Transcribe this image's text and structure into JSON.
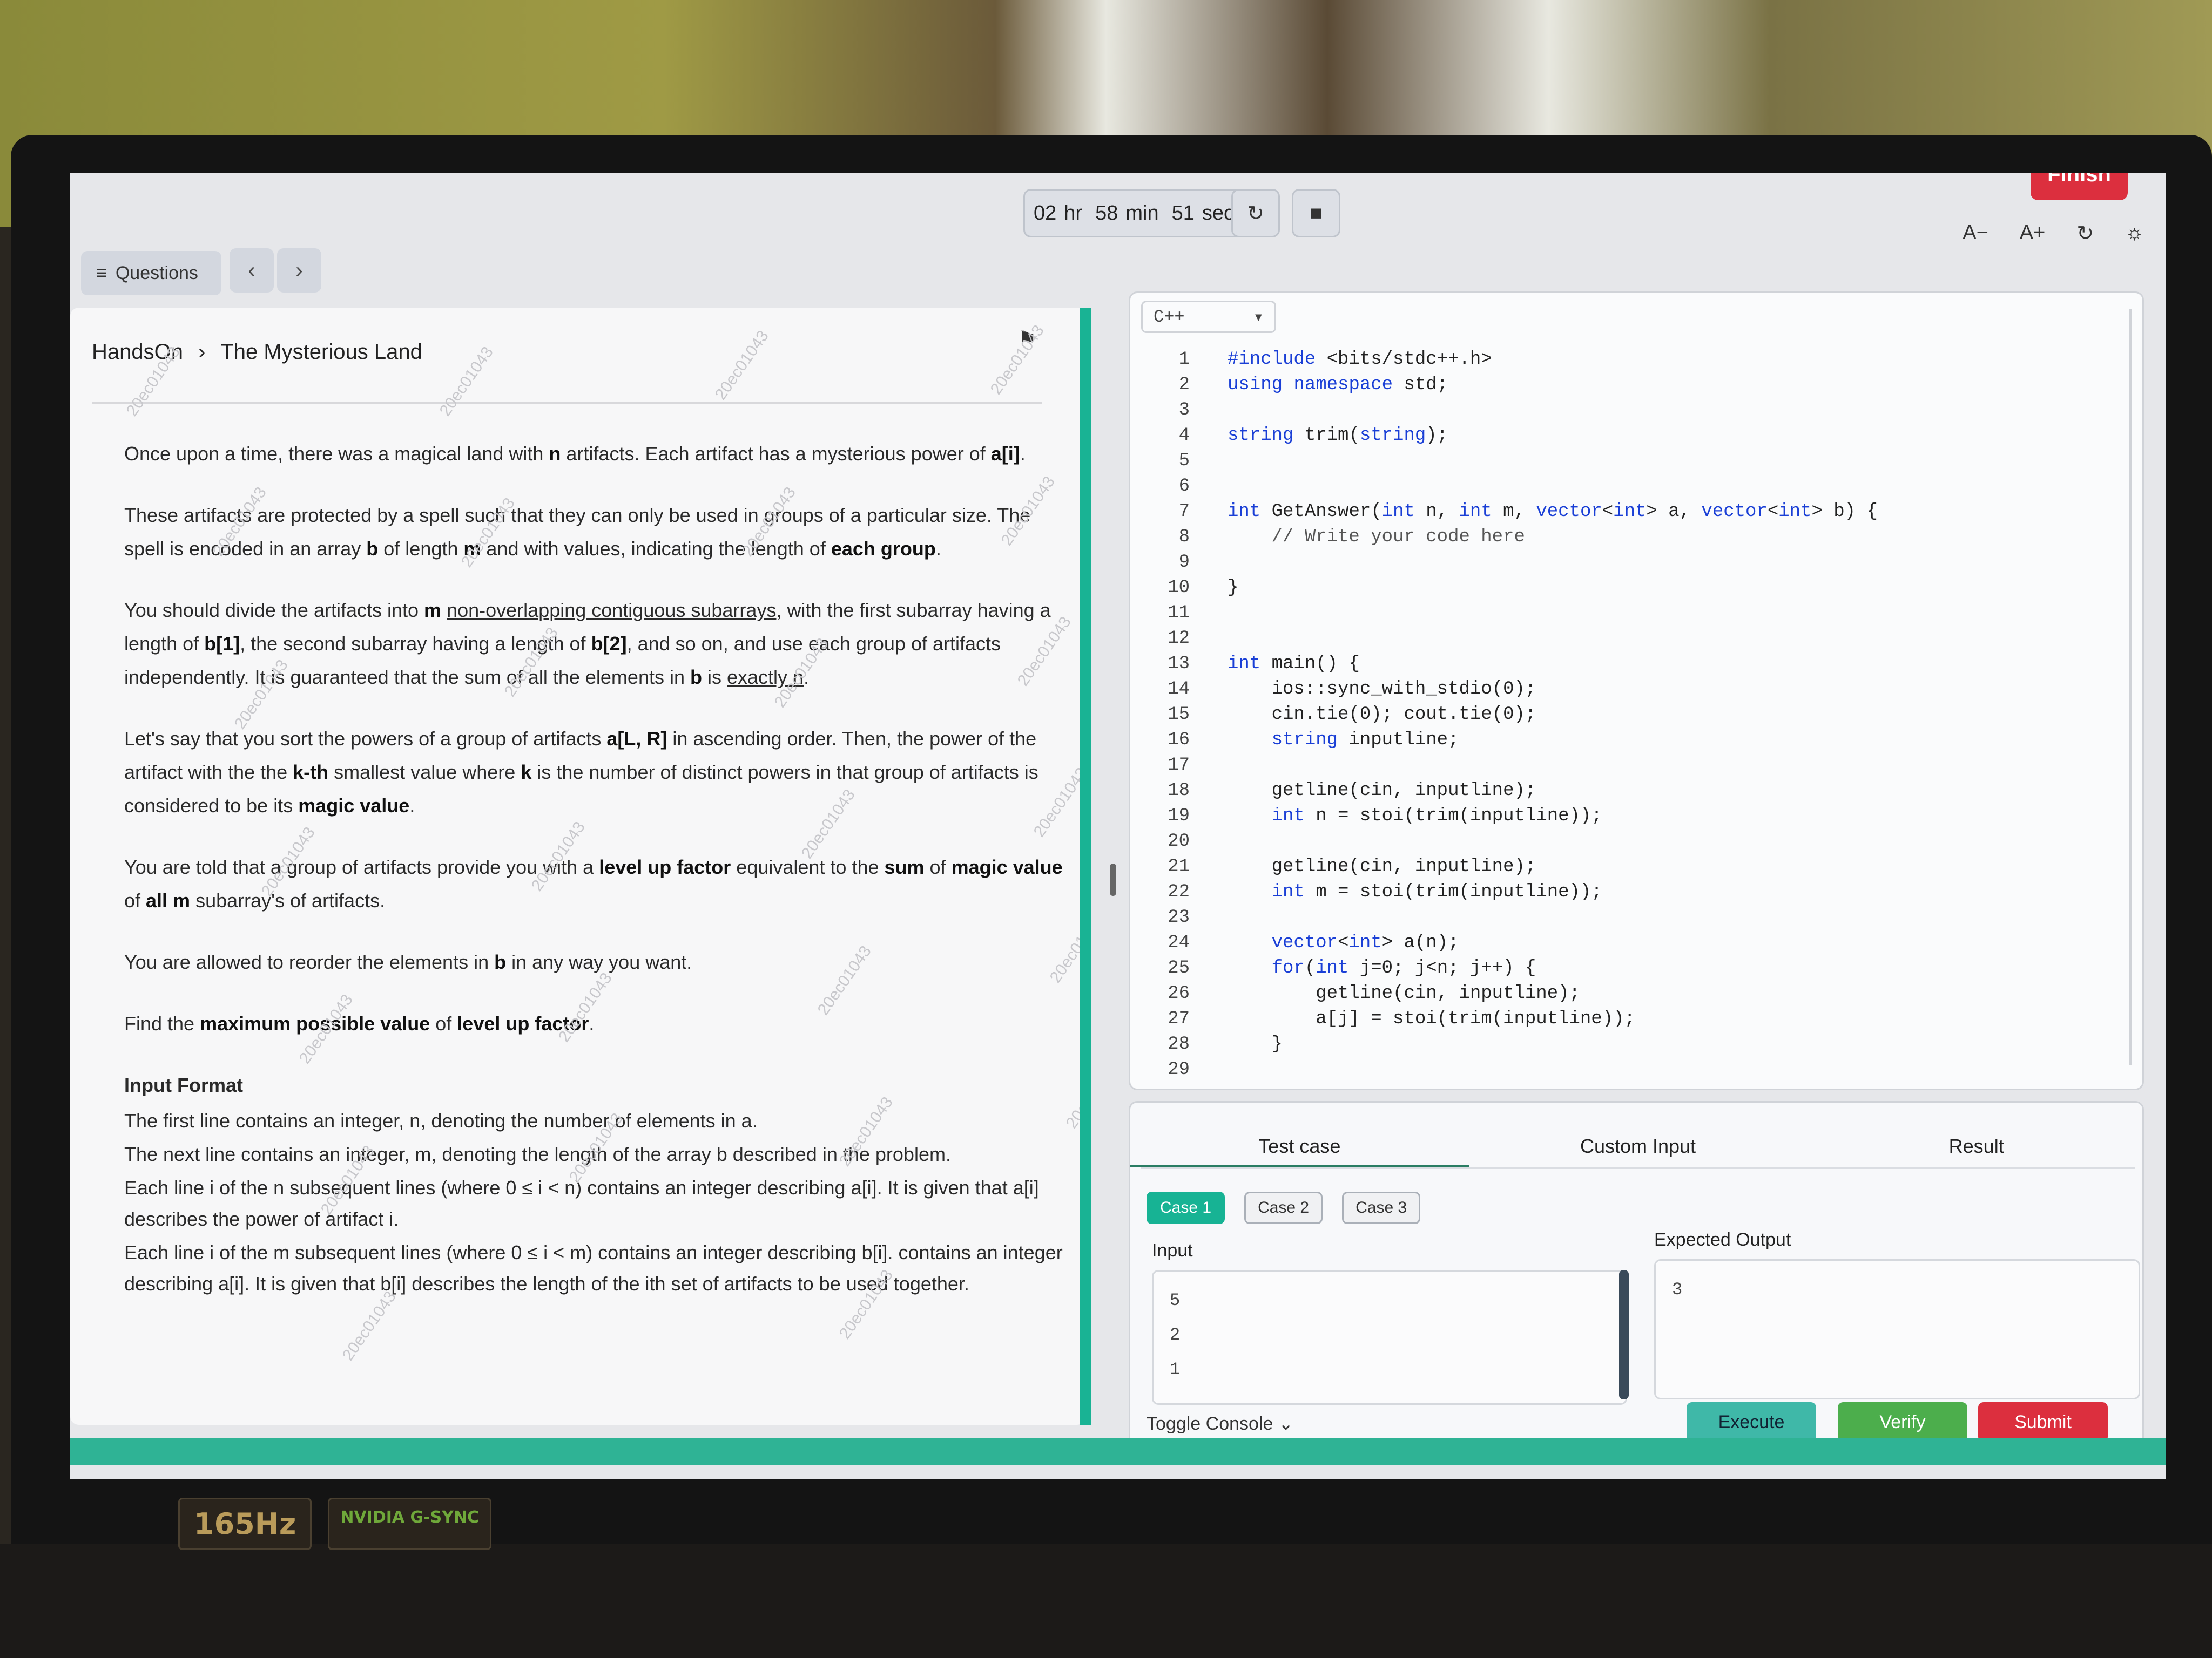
{
  "timer": {
    "hr": "02",
    "hr_unit": "hr",
    "min": "58",
    "min_unit": "min",
    "sec": "51",
    "sec_unit": "sec"
  },
  "toolbar": {
    "questions_label": "Questions",
    "prev_glyph": "‹",
    "next_glyph": "›",
    "refresh_glyph": "↻",
    "camera_glyph": "■",
    "finish_label": "Finish",
    "font_decrease": "A−",
    "font_increase": "A+",
    "reset_glyph": "↻",
    "theme_glyph": "☼"
  },
  "problem": {
    "breadcrumb_root": "HandsOn",
    "breadcrumb_sep": "›",
    "title": "The Mysterious Land",
    "flag_glyph": "⚑",
    "watermark": "20ec01043",
    "p1a": "Once upon a time, there was a magical land with ",
    "p1b": "n",
    "p1c": " artifacts. Each artifact has a mysterious power of ",
    "p1d": "a[i]",
    "p1e": ".",
    "p2a": "These artifacts are protected by a spell such that they can only be used in groups of a particular size. The spell is encoded in an array ",
    "p2b": "b",
    "p2c": " of length ",
    "p2d": "m",
    "p2e": " and with values, indicating the length of ",
    "p2f": "each group",
    "p2g": ".",
    "p3a": "You should divide the artifacts into ",
    "p3b": "m",
    "p3c": "non-overlapping contiguous subarrays",
    "p3d": ", with the first subarray having a length of ",
    "p3e": "b[1]",
    "p3f": ", the second subarray having a length of ",
    "p3g": "b[2]",
    "p3h": ", and so on, and use each group of artifacts independently. It is guaranteed that the sum of all the elements in ",
    "p3i": "b",
    "p3j": " is ",
    "p3k": "exactly n",
    "p3l": ".",
    "p4a": "Let's say that you sort the powers of a group of artifacts ",
    "p4b": "a[L, R]",
    "p4c": " in ascending order. Then, the power of the artifact with the the ",
    "p4d": "k-th",
    "p4e": " smallest value where ",
    "p4f": "k",
    "p4g": " is the number of distinct powers in that group of artifacts is considered to be its ",
    "p4h": "magic value",
    "p4i": ".",
    "p5a": "You are told that a group of artifacts provide you with a ",
    "p5b": "level up factor",
    "p5c": " equivalent to the ",
    "p5d": "sum",
    "p5e": " of ",
    "p5f": "magic value",
    "p5g": " of ",
    "p5h": "all m",
    "p5i": " subarray's of artifacts.",
    "p6a": "You are allowed to reorder the elements in ",
    "p6b": "b",
    "p6c": " in any way you want.",
    "p7a": "Find the ",
    "p7b": "maximum possible value",
    "p7c": " of ",
    "p7d": "level up factor",
    "p7e": ".",
    "input_format_title": "Input Format",
    "if1": "The first line contains an integer, n, denoting the number of elements in a.",
    "if2": "The next line contains an integer, m, denoting the length of the array b described in the problem.",
    "if3": "Each line i of the n subsequent lines (where 0 ≤ i < n) contains an integer describing a[i]. It is given that a[i] describes the power of artifact i.",
    "if4": "Each line i of the m subsequent lines (where 0 ≤ i < m) contains an integer describing b[i]. contains an integer describing a[i]. It is given that b[i] describes the length of the ith set of artifacts to be used together."
  },
  "editor": {
    "language": "C++",
    "dropdown_glyph": "▾",
    "lines": [
      "#include <bits/stdc++.h>",
      "using namespace std;",
      "",
      "string trim(string);",
      "",
      "",
      "int GetAnswer(int n, int m, vector<int> a, vector<int> b) {",
      "    // Write your code here",
      "",
      "}",
      "",
      "",
      "int main() {",
      "    ios::sync_with_stdio(0);",
      "    cin.tie(0); cout.tie(0);",
      "    string inputline;",
      "",
      "    getline(cin, inputline);",
      "    int n = stoi(trim(inputline));",
      "",
      "    getline(cin, inputline);",
      "    int m = stoi(trim(inputline));",
      "",
      "    vector<int> a(n);",
      "    for(int j=0; j<n; j++) {",
      "        getline(cin, inputline);",
      "        a[j] = stoi(trim(inputline));",
      "    }",
      ""
    ]
  },
  "console": {
    "tabs": [
      "Test case",
      "Custom Input",
      "Result"
    ],
    "cases": [
      "Case 1",
      "Case 2",
      "Case 3"
    ],
    "input_label": "Input",
    "expected_label": "Expected Output",
    "input_values": [
      "5",
      "2",
      "1"
    ],
    "expected_value": "3",
    "toggle_label": "Toggle Console",
    "toggle_glyph": "⌄",
    "execute_label": "Execute",
    "verify_label": "Verify",
    "submit_label": "Submit"
  },
  "hardware": {
    "sticker_hz": "165Hz",
    "sticker_gsync": "NVIDIA G-SYNC"
  },
  "colors": {
    "accent": "#17b394",
    "danger": "#dc2f3e",
    "verify": "#4cae4c",
    "keyword": "#1a3fd6"
  }
}
